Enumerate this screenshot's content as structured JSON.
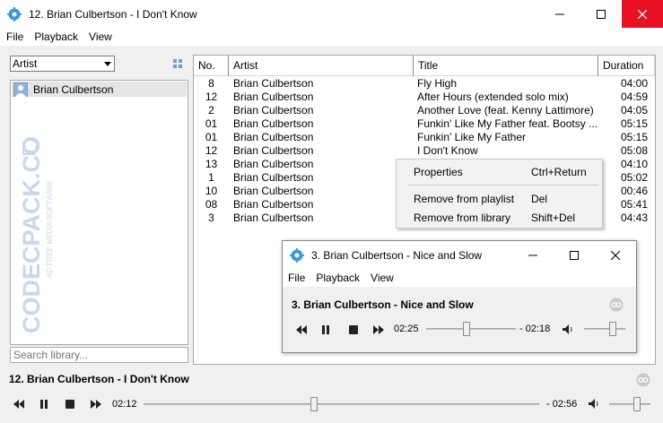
{
  "window": {
    "title": "12. Brian Culbertson - I Don't Know",
    "icon": "gear-app-icon",
    "accent_close": "#e81123"
  },
  "menu": [
    "File",
    "Playback",
    "View"
  ],
  "left": {
    "filter_select": "Artist",
    "artists": [
      "Brian Culbertson"
    ],
    "search_placeholder": "Search library...",
    "watermark_main": "CODECPACK.CO",
    "watermark_sub": "AD-FREE MEDIA SOFTWARE"
  },
  "table": {
    "headers": [
      "No.",
      "Artist",
      "Title",
      "Duration"
    ],
    "rows": [
      {
        "no": "8",
        "artist": "Brian Culbertson",
        "title": "Fly High",
        "duration": "04:00"
      },
      {
        "no": "12",
        "artist": "Brian Culbertson",
        "title": "After Hours (extended solo mix)",
        "duration": "04:59"
      },
      {
        "no": "2",
        "artist": "Brian Culbertson",
        "title": "Another Love (feat. Kenny Lattimore)",
        "duration": "04:05"
      },
      {
        "no": "01",
        "artist": "Brian Culbertson",
        "title": "Funkin' Like My Father feat. Bootsy ...",
        "duration": "05:15"
      },
      {
        "no": "01",
        "artist": "Brian Culbertson",
        "title": "Funkin' Like My Father",
        "duration": "05:15"
      },
      {
        "no": "12",
        "artist": "Brian Culbertson",
        "title": "I Don't Know",
        "duration": "05:08"
      },
      {
        "no": "13",
        "artist": "Brian Culbertson",
        "title": "",
        "duration": "04:10"
      },
      {
        "no": "1",
        "artist": "Brian Culbertson",
        "title": "",
        "duration": "05:02"
      },
      {
        "no": "10",
        "artist": "Brian Culbertson",
        "title": "",
        "duration": "00:46"
      },
      {
        "no": "08",
        "artist": "Brian Culbertson",
        "title": "",
        "duration": "05:41"
      },
      {
        "no": "3",
        "artist": "Brian Culbertson",
        "title": "",
        "duration": "04:43"
      }
    ]
  },
  "context_menu": {
    "properties": {
      "label": "Properties",
      "shortcut": "Ctrl+Return"
    },
    "remove_playlist": {
      "label": "Remove from playlist",
      "shortcut": "Del"
    },
    "remove_library": {
      "label": "Remove from library",
      "shortcut": "Shift+Del"
    }
  },
  "mini_player": {
    "title": "3. Brian Culbertson - Nice and Slow",
    "menu": [
      "File",
      "Playback",
      "View"
    ],
    "track": "3. Brian Culbertson - Nice and Slow",
    "elapsed": "02:25",
    "remaining": "- 02:18",
    "progress_fraction": 0.45,
    "volume_fraction": 0.7
  },
  "player": {
    "track": "12. Brian Culbertson - I Don't Know",
    "elapsed": "02:12",
    "remaining": "- 02:56",
    "progress_fraction": 0.43,
    "volume_fraction": 0.68
  }
}
